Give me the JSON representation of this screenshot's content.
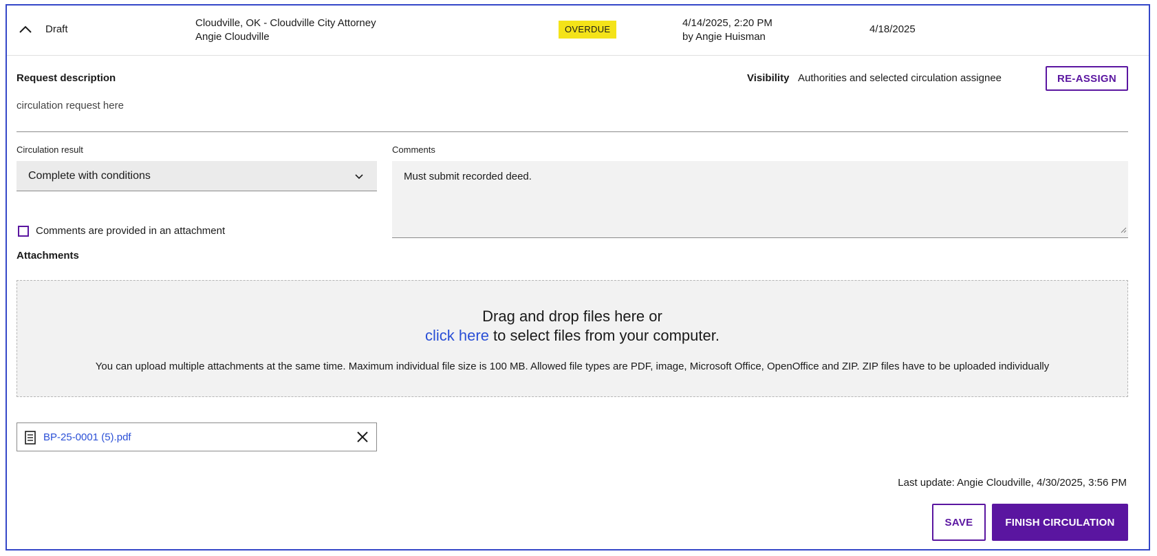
{
  "header": {
    "status": "Draft",
    "authority_line1": "Cloudville, OK - Cloudville City Attorney",
    "authority_line2": "Angie Cloudville",
    "badge": "OVERDUE",
    "created_line1": "4/14/2025, 2:20 PM",
    "created_line2": "by Angie Huisman",
    "due_date": "4/18/2025"
  },
  "request": {
    "title": "Request description",
    "description": "circulation request here",
    "visibility_label": "Visibility",
    "visibility_value": "Authorities and selected circulation assignee",
    "reassign_label": "RE-ASSIGN"
  },
  "form": {
    "result_label": "Circulation result",
    "result_value": "Complete with conditions",
    "comments_label": "Comments",
    "comments_value": "Must submit recorded deed.",
    "checkbox_label": "Comments are provided in an attachment",
    "checkbox_checked": false
  },
  "attachments": {
    "title": "Attachments",
    "drop_line1": "Drag and drop files here or",
    "drop_link": "click here",
    "drop_line2_rest": " to select files from your computer.",
    "drop_help": "You can upload multiple attachments at the same time. Maximum individual file size is 100 MB. Allowed file types are PDF, image, Microsoft Office, OpenOffice and ZIP. ZIP files have to be uploaded individually",
    "files": [
      {
        "name": "BP-25-0001 (5).pdf"
      }
    ]
  },
  "footer": {
    "last_update": "Last update: Angie Cloudville, 4/30/2025, 3:56 PM",
    "save_label": "SAVE",
    "finish_label": "FINISH CIRCULATION"
  },
  "colors": {
    "accent": "#5a15a0",
    "badge": "#f4e319",
    "link": "#2a4fd6",
    "frame": "#3346c8"
  },
  "icons": [
    "chevron-up-icon",
    "chevron-down-icon",
    "document-icon",
    "close-icon"
  ]
}
